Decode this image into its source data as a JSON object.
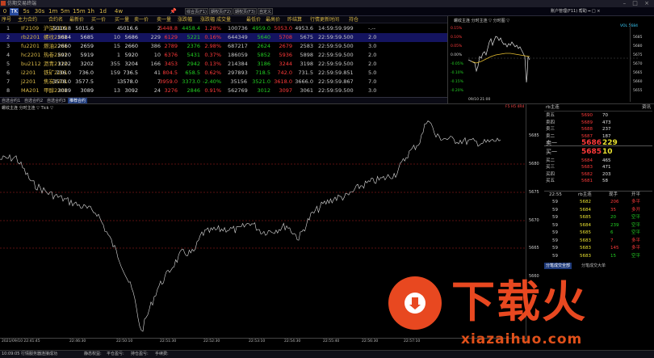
{
  "window": {
    "title": "仿期交易终端",
    "controls": "–  □  ×"
  },
  "timeframes": [
    {
      "label": "0",
      "sel": false
    },
    {
      "label": "TK",
      "sel": true
    },
    {
      "label": "5s",
      "sel": false
    },
    {
      "label": "30s",
      "sel": false
    },
    {
      "label": "1m",
      "sel": false
    },
    {
      "label": "5m",
      "sel": false
    },
    {
      "label": "15m",
      "sel": false
    },
    {
      "label": "1h",
      "sel": false
    },
    {
      "label": "1d",
      "sel": false
    },
    {
      "label": "4w",
      "sel": false
    }
  ],
  "page_buttons": [
    "综合页(F1)",
    "期权页(F2)",
    "期权页(F3)",
    "自定义"
  ],
  "right_menu": "账户管理(F11)  帮助  ━ □ ×",
  "quote_table": {
    "headers": [
      "序号",
      "主力合约",
      "合约名",
      "最新价",
      "买一价",
      "买一量",
      "卖一价",
      "卖一量",
      "涨跌幅",
      "涨跌幅",
      "成交量",
      "最低价",
      "最高价",
      "昨结算",
      "行情更新时间",
      "持仓"
    ],
    "rows": [
      [
        "1",
        "IF2109",
        "沪深2109",
        "5016.8",
        "5015.6",
        "4",
        "5016.6",
        "2",
        "5448.8",
        "4458.4",
        "1.28%",
        "100736",
        "4959.0",
        "5053.0",
        "4953.6",
        "14:59:59.999",
        "-.--"
      ],
      [
        "2",
        "rb2201",
        "螺纹2201",
        "5684",
        "5685",
        "10",
        "5686",
        "229",
        "6129",
        "5221",
        "0.16%",
        "644349",
        "5640",
        "5708",
        "5675",
        "22:59:59.500",
        "2.0"
      ],
      [
        "3",
        "fu2201",
        "燃油2201",
        "2660",
        "2659",
        "15",
        "2660",
        "386",
        "2789",
        "2376",
        "2.98%",
        "687217",
        "2624",
        "2679",
        "2583",
        "22:59:59.500",
        "3.0"
      ],
      [
        "4",
        "hc2201",
        "热卷2201",
        "5920",
        "5919",
        "1",
        "5920",
        "10",
        "6376",
        "5431",
        "0.37%",
        "186059",
        "5852",
        "5936",
        "5898",
        "22:59:59.500",
        "2.0"
      ],
      [
        "5",
        "bu2112",
        "沥青2112",
        "3202",
        "3202",
        "355",
        "3204",
        "166",
        "3453",
        "2942",
        "0.13%",
        "214384",
        "3186",
        "3244",
        "3198",
        "22:59:59.500",
        "2.0"
      ],
      [
        "6",
        "i2201",
        "铁矿2201",
        "736.0",
        "736.0",
        "159",
        "736.5",
        "41",
        "804.5",
        "658.5",
        "0.62%",
        "297893",
        "718.5",
        "742.0",
        "731.5",
        "22:59:59.851",
        "5.0"
      ],
      [
        "7",
        "j2201",
        "焦炭2201",
        "3578.0",
        "3577.5",
        "1",
        "3578.0",
        "7",
        "3959.0",
        "3373.0",
        "-2.40%",
        "35156",
        "3521.0",
        "3618.0",
        "3666.0",
        "22:59:59.867",
        "7.0"
      ],
      [
        "8",
        "MA201",
        "甲醇2201",
        "3089",
        "3089",
        "13",
        "3092",
        "24",
        "3276",
        "2846",
        "0.91%",
        "562769",
        "3012",
        "3097",
        "3061",
        "22:59:59.500",
        "3.0"
      ]
    ]
  },
  "sub_tabs": [
    {
      "label": "自选合约1",
      "act": false
    },
    {
      "label": "自选合约2",
      "act": false
    },
    {
      "label": "自选合约3",
      "act": false
    },
    {
      "label": "推荐合约",
      "act": true
    }
  ],
  "mini_chart": {
    "header": "螺纹主连 分时主连 ▽  分时图 ▽",
    "right_note": "VOL 5684",
    "left_axis": [
      "0.15%",
      "0.10%",
      "0.05%",
      "0.00%",
      "-0.05%",
      "-0.10%",
      "-0.15%",
      "-0.20%"
    ],
    "right_axis": [
      "5685",
      "5680",
      "5675",
      "5670",
      "5665",
      "5660",
      "5655"
    ],
    "time_label": "09/10 21:00"
  },
  "main_chart": {
    "header": "螺纹主连 分时主连 ▽  Tick ▽",
    "right_note": "F5 H5 4R4",
    "y_ticks": [
      "5685",
      "5680",
      "5675",
      "5670",
      "5665",
      "5660"
    ],
    "x_ticks": [
      "2021/09/10 22:41:45",
      "22:46:30",
      "22:50:10",
      "22:51:30",
      "22:52:30",
      "22:53:10",
      "22:54:30",
      "22:55:40",
      "22:56:30",
      "22:57:10"
    ]
  },
  "order_book": {
    "title": "rb主连",
    "right": "资讯",
    "asks": [
      {
        "label": "卖五",
        "price": "5690",
        "vol": "70"
      },
      {
        "label": "卖四",
        "price": "5689",
        "vol": "473"
      },
      {
        "label": "卖三",
        "price": "5688",
        "vol": "237"
      },
      {
        "label": "卖二",
        "price": "5687",
        "vol": "187"
      },
      {
        "label": "卖一",
        "price": "5686",
        "vol": "229"
      }
    ],
    "bids": [
      {
        "label": "买一",
        "price": "5685",
        "vol": "10"
      },
      {
        "label": "买二",
        "price": "5684",
        "vol": "465"
      },
      {
        "label": "买三",
        "price": "5683",
        "vol": "471"
      },
      {
        "label": "买四",
        "price": "5682",
        "vol": "203"
      },
      {
        "label": "买五",
        "price": "5681",
        "vol": "58"
      }
    ]
  },
  "trades": {
    "headers": [
      "22:55",
      "rb主连",
      "现手",
      "开平"
    ],
    "rows": [
      [
        "59",
        "5682",
        "206",
        "多平"
      ],
      [
        "59",
        "5684",
        "35",
        "多开"
      ],
      [
        "59",
        "5685",
        "20",
        "空平"
      ],
      [
        "59",
        "5684",
        "239",
        "空平"
      ],
      [
        "59",
        "5685",
        "6",
        "空平"
      ],
      [
        "59",
        "5683",
        "7",
        "多平"
      ],
      [
        "59",
        "5683",
        "145",
        "多平"
      ],
      [
        "59",
        "5683",
        "15",
        "空平"
      ]
    ],
    "tabs": [
      "分笔成交全部",
      "分笔成交大单"
    ]
  },
  "watermark": {
    "big": "下载火",
    "url": "xiazaihuo.com"
  },
  "status_bar": [
    "10:09:05 行情服务器连接成功",
    "静态权益:",
    "平仓盈亏:",
    "持仓盈亏:",
    "手续费:"
  ],
  "colors": {
    "up": "#ff3a3a",
    "down": "#23d023",
    "accent": "#264aa0",
    "watermark": "#e84820"
  }
}
